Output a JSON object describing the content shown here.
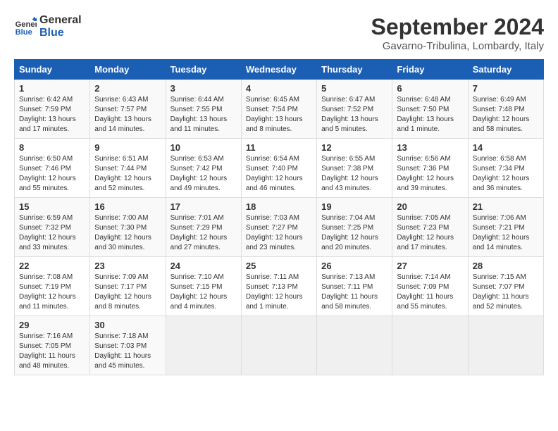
{
  "logo": {
    "line1": "General",
    "line2": "Blue"
  },
  "title": "September 2024",
  "location": "Gavarno-Tribulina, Lombardy, Italy",
  "weekdays": [
    "Sunday",
    "Monday",
    "Tuesday",
    "Wednesday",
    "Thursday",
    "Friday",
    "Saturday"
  ],
  "weeks": [
    [
      {
        "day": "1",
        "sunrise": "6:42 AM",
        "sunset": "7:59 PM",
        "daylight": "13 hours and 17 minutes."
      },
      {
        "day": "2",
        "sunrise": "6:43 AM",
        "sunset": "7:57 PM",
        "daylight": "13 hours and 14 minutes."
      },
      {
        "day": "3",
        "sunrise": "6:44 AM",
        "sunset": "7:55 PM",
        "daylight": "13 hours and 11 minutes."
      },
      {
        "day": "4",
        "sunrise": "6:45 AM",
        "sunset": "7:54 PM",
        "daylight": "13 hours and 8 minutes."
      },
      {
        "day": "5",
        "sunrise": "6:47 AM",
        "sunset": "7:52 PM",
        "daylight": "13 hours and 5 minutes."
      },
      {
        "day": "6",
        "sunrise": "6:48 AM",
        "sunset": "7:50 PM",
        "daylight": "13 hours and 1 minute."
      },
      {
        "day": "7",
        "sunrise": "6:49 AM",
        "sunset": "7:48 PM",
        "daylight": "12 hours and 58 minutes."
      }
    ],
    [
      {
        "day": "8",
        "sunrise": "6:50 AM",
        "sunset": "7:46 PM",
        "daylight": "12 hours and 55 minutes."
      },
      {
        "day": "9",
        "sunrise": "6:51 AM",
        "sunset": "7:44 PM",
        "daylight": "12 hours and 52 minutes."
      },
      {
        "day": "10",
        "sunrise": "6:53 AM",
        "sunset": "7:42 PM",
        "daylight": "12 hours and 49 minutes."
      },
      {
        "day": "11",
        "sunrise": "6:54 AM",
        "sunset": "7:40 PM",
        "daylight": "12 hours and 46 minutes."
      },
      {
        "day": "12",
        "sunrise": "6:55 AM",
        "sunset": "7:38 PM",
        "daylight": "12 hours and 43 minutes."
      },
      {
        "day": "13",
        "sunrise": "6:56 AM",
        "sunset": "7:36 PM",
        "daylight": "12 hours and 39 minutes."
      },
      {
        "day": "14",
        "sunrise": "6:58 AM",
        "sunset": "7:34 PM",
        "daylight": "12 hours and 36 minutes."
      }
    ],
    [
      {
        "day": "15",
        "sunrise": "6:59 AM",
        "sunset": "7:32 PM",
        "daylight": "12 hours and 33 minutes."
      },
      {
        "day": "16",
        "sunrise": "7:00 AM",
        "sunset": "7:30 PM",
        "daylight": "12 hours and 30 minutes."
      },
      {
        "day": "17",
        "sunrise": "7:01 AM",
        "sunset": "7:29 PM",
        "daylight": "12 hours and 27 minutes."
      },
      {
        "day": "18",
        "sunrise": "7:03 AM",
        "sunset": "7:27 PM",
        "daylight": "12 hours and 23 minutes."
      },
      {
        "day": "19",
        "sunrise": "7:04 AM",
        "sunset": "7:25 PM",
        "daylight": "12 hours and 20 minutes."
      },
      {
        "day": "20",
        "sunrise": "7:05 AM",
        "sunset": "7:23 PM",
        "daylight": "12 hours and 17 minutes."
      },
      {
        "day": "21",
        "sunrise": "7:06 AM",
        "sunset": "7:21 PM",
        "daylight": "12 hours and 14 minutes."
      }
    ],
    [
      {
        "day": "22",
        "sunrise": "7:08 AM",
        "sunset": "7:19 PM",
        "daylight": "12 hours and 11 minutes."
      },
      {
        "day": "23",
        "sunrise": "7:09 AM",
        "sunset": "7:17 PM",
        "daylight": "12 hours and 8 minutes."
      },
      {
        "day": "24",
        "sunrise": "7:10 AM",
        "sunset": "7:15 PM",
        "daylight": "12 hours and 4 minutes."
      },
      {
        "day": "25",
        "sunrise": "7:11 AM",
        "sunset": "7:13 PM",
        "daylight": "12 hours and 1 minute."
      },
      {
        "day": "26",
        "sunrise": "7:13 AM",
        "sunset": "7:11 PM",
        "daylight": "11 hours and 58 minutes."
      },
      {
        "day": "27",
        "sunrise": "7:14 AM",
        "sunset": "7:09 PM",
        "daylight": "11 hours and 55 minutes."
      },
      {
        "day": "28",
        "sunrise": "7:15 AM",
        "sunset": "7:07 PM",
        "daylight": "11 hours and 52 minutes."
      }
    ],
    [
      {
        "day": "29",
        "sunrise": "7:16 AM",
        "sunset": "7:05 PM",
        "daylight": "11 hours and 48 minutes."
      },
      {
        "day": "30",
        "sunrise": "7:18 AM",
        "sunset": "7:03 PM",
        "daylight": "11 hours and 45 minutes."
      },
      null,
      null,
      null,
      null,
      null
    ]
  ]
}
